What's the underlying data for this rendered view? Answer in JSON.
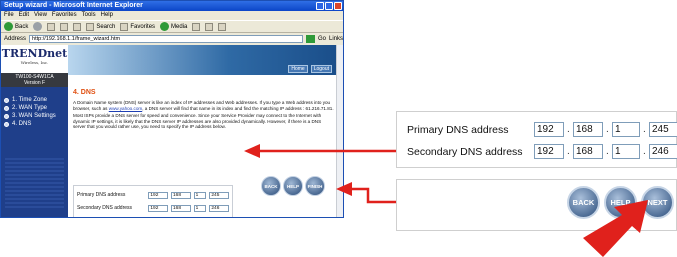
{
  "browser": {
    "title": "Setup wizard - Microsoft Internet Explorer",
    "menu": [
      "File",
      "Edit",
      "View",
      "Favorites",
      "Tools",
      "Help"
    ],
    "toolbar": {
      "back": "Back",
      "search": "Search",
      "favorites": "Favorites",
      "media": "Media"
    },
    "address_label": "Address",
    "address_value": "http://192.168.1.1/frame_wizard.htm",
    "go_label": "Go",
    "links_label": "Links"
  },
  "sidebar": {
    "logo": "TRENDnet",
    "logo_tagline": "Wireless, Inc.",
    "model": "TW100-S4W1CA",
    "version": "Version F",
    "steps": [
      "1. Time Zone",
      "2. WAN Type",
      "3. WAN Settings",
      "4. DNS"
    ]
  },
  "banner": {
    "home": "Home",
    "logout": "Logout"
  },
  "main": {
    "title": "4. DNS",
    "para1_before_link": "A Domain Name system (DNS) server is like an index of IP addresses and Web addresses. If you type a Web address into you browser, such as ",
    "para1_link": "www.yahoo.com",
    "para1_after_link": ", a DNS server will find that name in its index and find the matching IP address : 61.216.71.81.",
    "para2": "Most ISPs provide a DNS server for speed and convenience. Since your Service Provider may connect to the Internet with dynamic IP settings, it is likely that the DNS server IP addresses are also provided dynamically. However, if there is a DNS server that you would rather use, you need to specify the IP address below."
  },
  "dns": {
    "primary_label": "Primary DNS address",
    "primary": [
      "192",
      "168",
      "1",
      "245"
    ],
    "secondary_label": "Secondary DNS address",
    "secondary": [
      "192",
      "168",
      "1",
      "246"
    ]
  },
  "buttons": {
    "back": "BACK",
    "help": "HELP",
    "finish": "FINISH",
    "next": "NEXT"
  },
  "colors": {
    "arrow": "#e0211c",
    "title": "#e04f10",
    "sidebar": "#1f3f8a"
  }
}
